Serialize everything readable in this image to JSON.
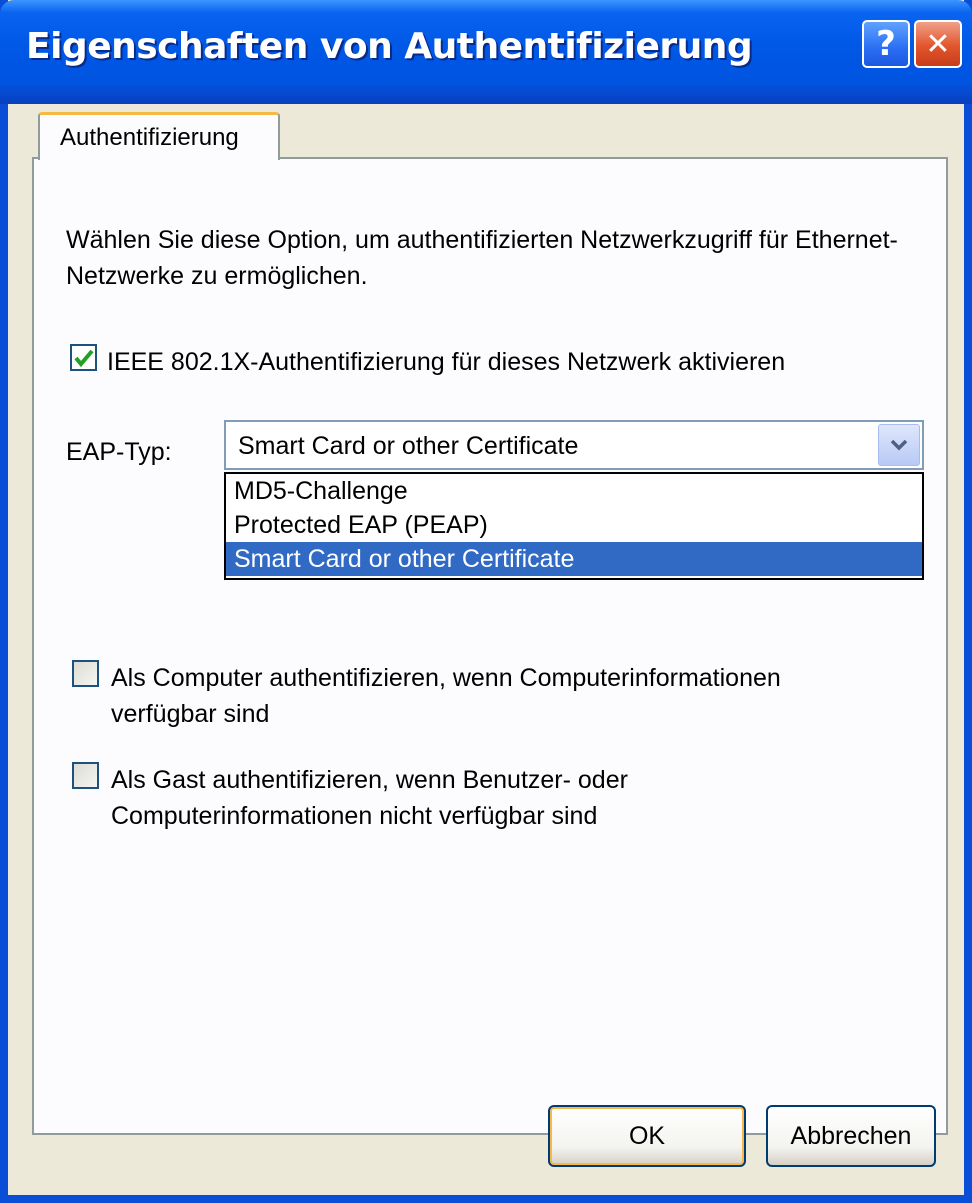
{
  "window": {
    "title": "Eigenschaften von Authentifizierung",
    "help_label": "?",
    "close_label": "✕"
  },
  "tabs": [
    {
      "label": "Authentifizierung",
      "active": true
    }
  ],
  "description": "Wählen Sie diese Option, um authentifizierten Netzwerkzugriff für Ethernet-Netzwerke zu ermöglichen.",
  "ieee_checkbox": {
    "label": "IEEE 802.1X-Authentifizierung für dieses Netzwerk aktivieren",
    "checked": true
  },
  "eap": {
    "label": "EAP-Typ:",
    "selected": "Smart Card or other Certificate",
    "options": [
      "MD5-Challenge",
      "Protected EAP (PEAP)",
      "Smart Card or other Certificate"
    ]
  },
  "computer_checkbox": {
    "label_line1": "Als Computer authentifizieren, wenn Computerinformationen",
    "label_line2": "verfügbar sind",
    "checked": false
  },
  "guest_checkbox": {
    "label_line1": "Als Gast authentifizieren, wenn Benutzer- oder",
    "label_line2": "Computerinformationen nicht verfügbar sind",
    "checked": false
  },
  "buttons": {
    "ok": "OK",
    "cancel": "Abbrechen"
  },
  "colors": {
    "titlebar": "#0058e6",
    "selection": "#316ac5",
    "check": "#21a121"
  }
}
